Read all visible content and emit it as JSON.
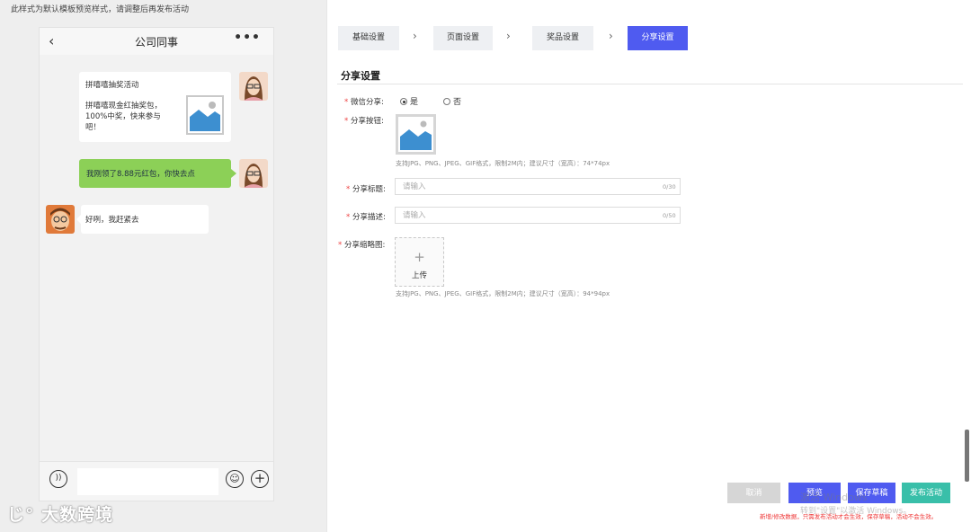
{
  "notice": "此样式为默认模板预览样式，请调整后再发布活动",
  "phone": {
    "title": "公司同事",
    "back_icon": "‹",
    "more_icon": "•••",
    "card": {
      "title": "拼嘻嘻抽奖活动",
      "body": "拼嘻嘻现金红抽奖包，100%中奖，快来参与吧！"
    },
    "green_message": "我刚领了8.88元红包，你快去点",
    "reply_message": "好咧，我赶紧去",
    "voice_icon": "))",
    "emoji_icon": "☺",
    "plus_icon": "+"
  },
  "watermark_logo": "大数跨境",
  "steps": [
    "基础设置",
    "页面设置",
    "奖品设置",
    "分享设置"
  ],
  "step_arrow": "›",
  "section_title": "分享设置",
  "form": {
    "wechat_share_label": "微信分享:",
    "radio_yes": "是",
    "radio_no": "否",
    "share_button_label": "分享按钮:",
    "share_button_hint": "支持JPG、PNG、JPEG、GIF格式，限制2M内；建议尺寸（宽高）：74*74px",
    "share_title_label": "分享标题:",
    "share_title_placeholder": "请输入",
    "share_title_count": "0/30",
    "share_desc_label": "分享描述:",
    "share_desc_placeholder": "请输入",
    "share_desc_count": "0/50",
    "thumb_label": "分享缩略图:",
    "upload_plus": "+",
    "upload_label": "上传",
    "thumb_hint": "支持JPG、PNG、JPEG、GIF格式，限制2M内；建议尺寸（宽高）：94*94px",
    "required_mark": "*"
  },
  "buttons": {
    "cancel": "取消",
    "preview": "预览",
    "save_draft": "保存草稿",
    "publish": "发布活动"
  },
  "red_note": "新增/修改数据，只需发布活动才会生效，保存草稿，活动不会生效。",
  "windows_watermark": {
    "line1": "激活 Windows",
    "line2": "转到\"设置\"以激活 Windows。"
  },
  "colors": {
    "primary": "#4f5bf0",
    "publish": "#39bfa9",
    "chat_green": "#8cd057"
  }
}
